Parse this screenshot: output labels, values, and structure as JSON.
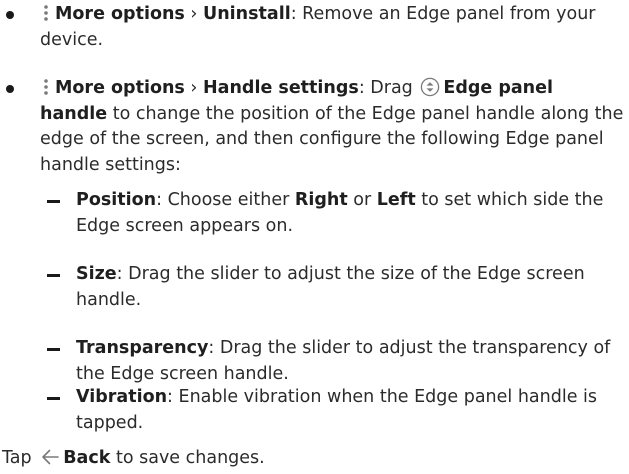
{
  "items": [
    {
      "label": "More options",
      "sep": "›",
      "target": "Uninstall",
      "desc": ": Remove an Edge panel from your device."
    },
    {
      "label": "More options",
      "sep": "›",
      "target": "Handle settings",
      "desc_pre": ": Drag",
      "handle_label": "Edge panel handle",
      "desc_post": "to change the position of the Edge panel handle along the edge of the screen, and then configure the following Edge panel handle settings:"
    }
  ],
  "sub_items": [
    {
      "term": "Position",
      "pre": ": Choose either ",
      "opt1": "Right",
      "mid": " or ",
      "opt2": "Left",
      "post": " to set which side the Edge screen appears on."
    },
    {
      "term": "Size",
      "desc": ": Drag the slider to adjust the size of the Edge screen handle."
    },
    {
      "term": "Transparency",
      "desc": ": Drag the slider to adjust the transparency of the Edge screen handle."
    },
    {
      "term": "Vibration",
      "desc": ": Enable vibration when the Edge panel handle is tapped."
    }
  ],
  "footer": {
    "pre": "Tap",
    "back_label": "Back",
    "post": "to save changes."
  },
  "icons": {
    "more_options": "kebab-vertical-icon",
    "handle": "edge-panel-handle-icon",
    "back": "back-arrow-icon"
  }
}
